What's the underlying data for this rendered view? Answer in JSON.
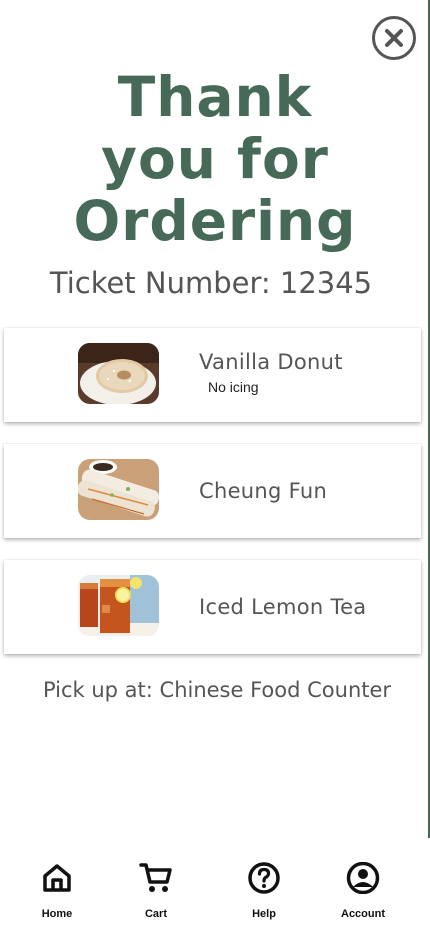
{
  "header": {
    "title_lines": [
      "Thank",
      "you for",
      "Ordering"
    ],
    "ticket_label": "Ticket Number: 12345",
    "close_icon": "close-circle-icon"
  },
  "order": {
    "items": [
      {
        "name": "Vanilla Donut",
        "note": "No icing",
        "image": "vanilla-donut-photo"
      },
      {
        "name": "Cheung Fun",
        "note": "",
        "image": "cheung-fun-photo"
      },
      {
        "name": "Iced Lemon Tea",
        "note": "",
        "image": "iced-lemon-tea-photo"
      }
    ]
  },
  "pickup": {
    "text": "Pick up at: Chinese Food Counter"
  },
  "nav": {
    "items": [
      {
        "label": "Home",
        "icon": "home-icon"
      },
      {
        "label": "Cart",
        "icon": "cart-icon"
      },
      {
        "label": "Help",
        "icon": "help-icon"
      },
      {
        "label": "Account",
        "icon": "account-icon"
      }
    ]
  },
  "colors": {
    "accent": "#476a58",
    "text_muted": "#555555",
    "nav_text": "#111111"
  }
}
